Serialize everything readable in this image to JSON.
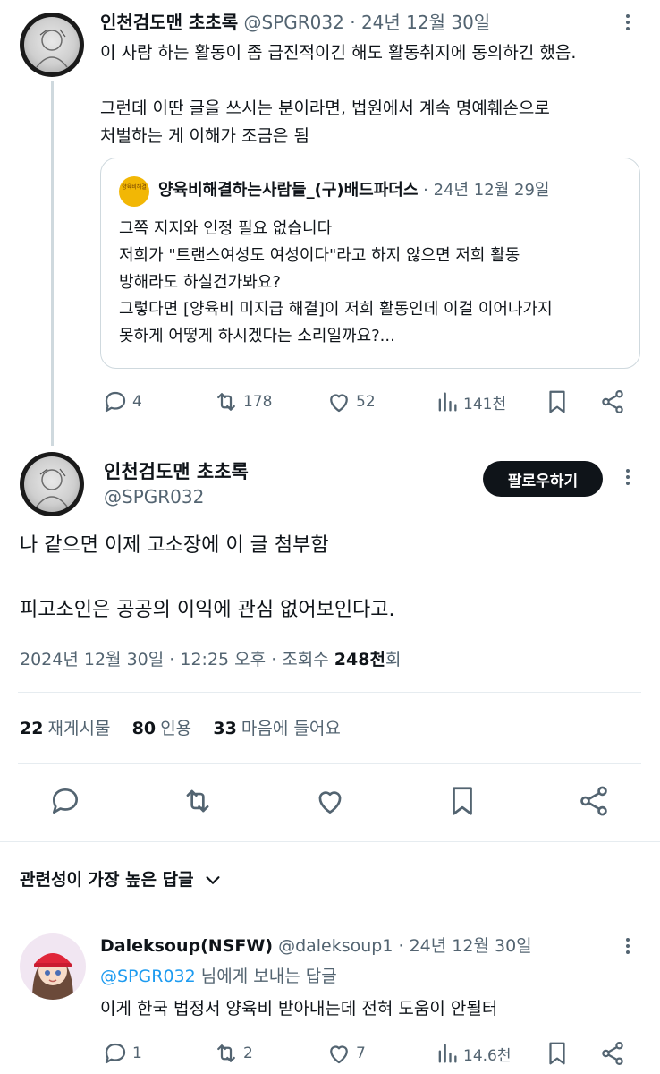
{
  "parent_tweet": {
    "display_name": "인천검도맨 초초록",
    "handle": "@SPGR032",
    "dot": "·",
    "date": "24년 12월 30일",
    "text_lines": [
      "이 사람 하는 활동이 좀 급진적이긴 해도 활동취지에 동의하긴 했음.",
      "그런데 이딴 글을 쓰시는 분이라면, 법원에서 계속 명예훼손으로",
      "처벌하는 게 이해가 조금은 됨"
    ],
    "quote": {
      "avatar_text": "양육비해결",
      "display_name": "양육비해결하는사람들_(구)배드파더스",
      "dot": "·",
      "date": "24년 12월 29일",
      "text_lines": [
        "그쪽 지지와 인정 필요 없습니다",
        "저희가 \"트랜스여성도 여성이다\"라고 하지 않으면 저희 활동",
        "방해라도 하실건가봐요?",
        "그렇다면 [양육비 미지급 해결]이 저희 활동인데 이걸 이어나가지",
        "못하게 어떻게 하시겠다는 소리일까요?..."
      ]
    },
    "actions": {
      "reply_count": "4",
      "retweet_count": "178",
      "like_count": "52",
      "view_count": "141천"
    }
  },
  "main_tweet": {
    "display_name": "인천검도맨 초초록",
    "handle": "@SPGR032",
    "follow_label": "팔로우하기",
    "text_lines": [
      "나 같으면 이제 고소장에 이 글 첨부함",
      "피고소인은 공공의 이익에 관심 없어보인다고."
    ],
    "meta": {
      "date": "2024년 12월 30일",
      "sep1": "·",
      "time": "12:25 오후",
      "sep2": "·",
      "views_label": "조회수",
      "views_value": "248천",
      "views_suffix": "회"
    },
    "stats": {
      "retweets_num": "22",
      "retweets_label": "재게시물",
      "quotes_num": "80",
      "quotes_label": "인용",
      "likes_num": "33",
      "likes_label": "마음에 들어요"
    }
  },
  "replies_header": {
    "label": "관련성이 가장 높은 답글"
  },
  "reply": {
    "display_name": "Daleksoup(NSFW)",
    "handle": "@daleksoup1",
    "dot": "·",
    "date": "24년 12월 30일",
    "replying_mention": "@SPGR032",
    "replying_suffix": "님에게 보내는 답글",
    "text": "이게 한국 법정서 양육비 받아내는데 전혀 도움이 안될터",
    "actions": {
      "reply_count": "1",
      "retweet_count": "2",
      "like_count": "7",
      "view_count": "14.6천"
    }
  },
  "colors": {
    "text_primary": "#0f1419",
    "text_secondary": "#536471",
    "link": "#1d9bf0",
    "follow_button_bg": "#0f1419",
    "divider": "#e6ecf0"
  },
  "icons": [
    "reply-icon",
    "retweet-icon",
    "like-icon",
    "views-icon",
    "bookmark-icon",
    "share-icon",
    "more-icon",
    "chevron-down-icon"
  ]
}
